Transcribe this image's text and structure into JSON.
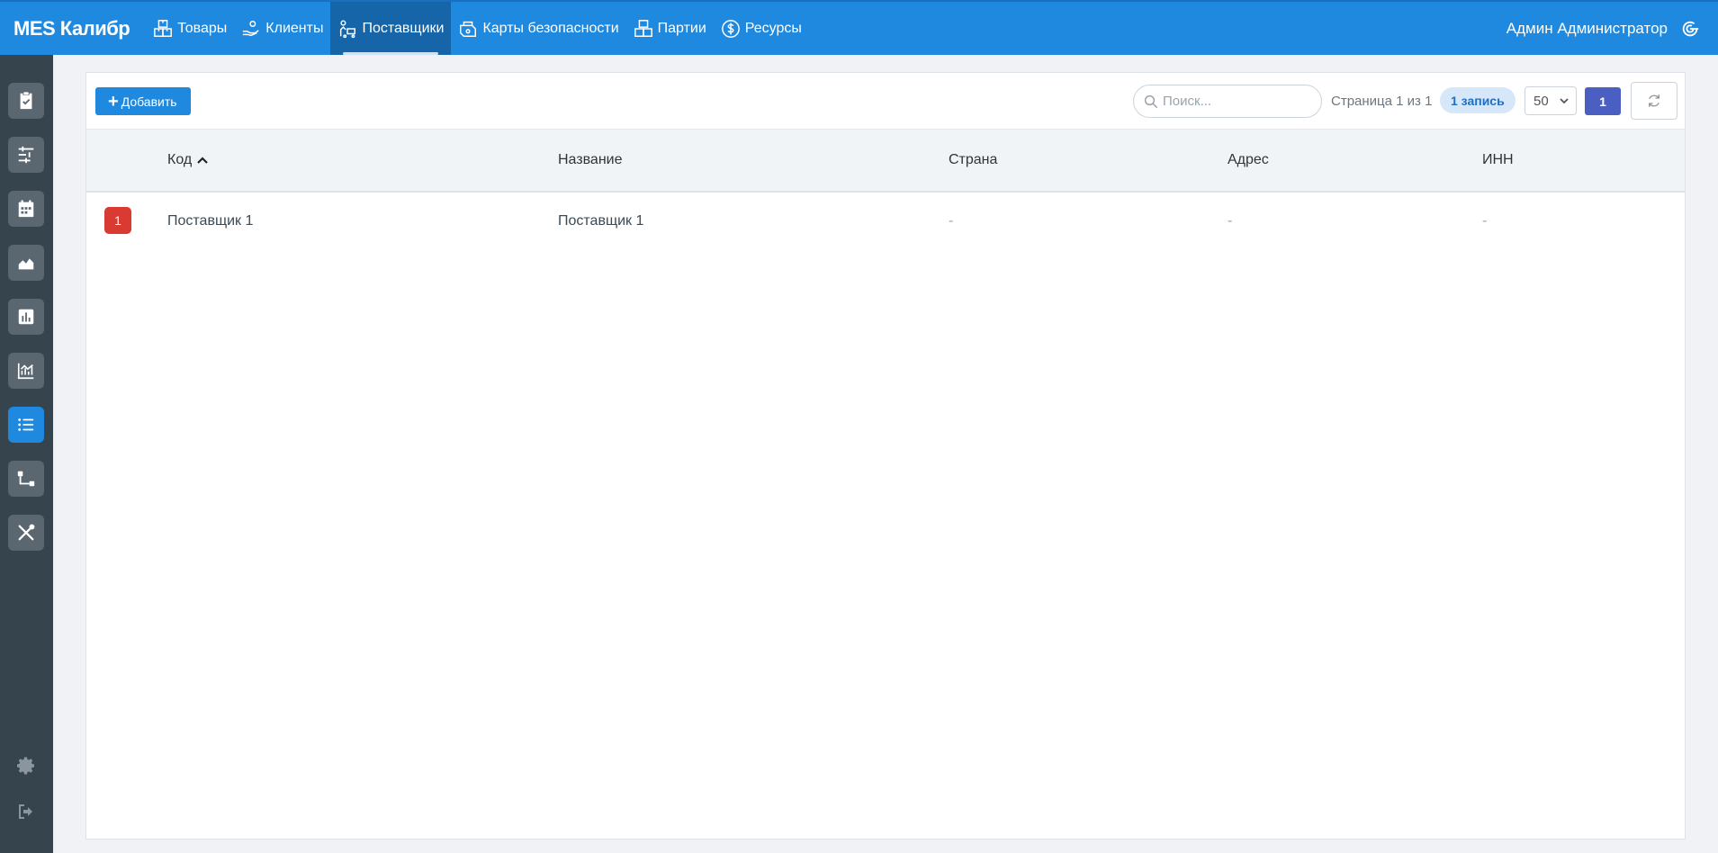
{
  "app": {
    "brand": "MES Калибр"
  },
  "nav": {
    "items": [
      {
        "label": "Товары",
        "icon": "boxes-icon"
      },
      {
        "label": "Клиенты",
        "icon": "hand-coins-icon"
      },
      {
        "label": "Поставщики",
        "icon": "supplier-icon",
        "active": true
      },
      {
        "label": "Карты безопасности",
        "icon": "safety-card-icon"
      },
      {
        "label": "Партии",
        "icon": "batch-icon"
      },
      {
        "label": "Ресурсы",
        "icon": "dollar-icon"
      }
    ]
  },
  "user": {
    "name": "Админ Администратор",
    "icon": "app-logo-icon"
  },
  "sidebar": {
    "items": [
      {
        "icon": "clipboard-check-icon"
      },
      {
        "icon": "sliders-icon"
      },
      {
        "icon": "calendar-icon"
      },
      {
        "icon": "area-chart-icon"
      },
      {
        "icon": "bar-chart-icon"
      },
      {
        "icon": "line-chart-icon"
      },
      {
        "icon": "list-icon",
        "active": true
      },
      {
        "icon": "flow-icon"
      },
      {
        "icon": "tools-icon"
      }
    ],
    "bottom": [
      {
        "icon": "gear-icon"
      },
      {
        "icon": "logout-icon"
      }
    ]
  },
  "toolbar": {
    "add_label": "Добавить",
    "search_placeholder": "Поиск...",
    "page_info": "Страница 1 из 1",
    "records": "1 запись",
    "per_page": "50",
    "current_page": "1"
  },
  "table": {
    "columns": [
      "Код",
      "Название",
      "Страна",
      "Адрес",
      "ИНН"
    ],
    "sort_column": "Код",
    "rows": [
      {
        "index": "1",
        "code": "Поставщик 1",
        "name": "Поставщик 1",
        "country": "-",
        "address": "-",
        "inn": "-"
      }
    ]
  },
  "colors": {
    "primary": "#1f89e0",
    "sidebar": "#36444e",
    "badge": "#d93a32",
    "page_button": "#4a5fc1"
  }
}
